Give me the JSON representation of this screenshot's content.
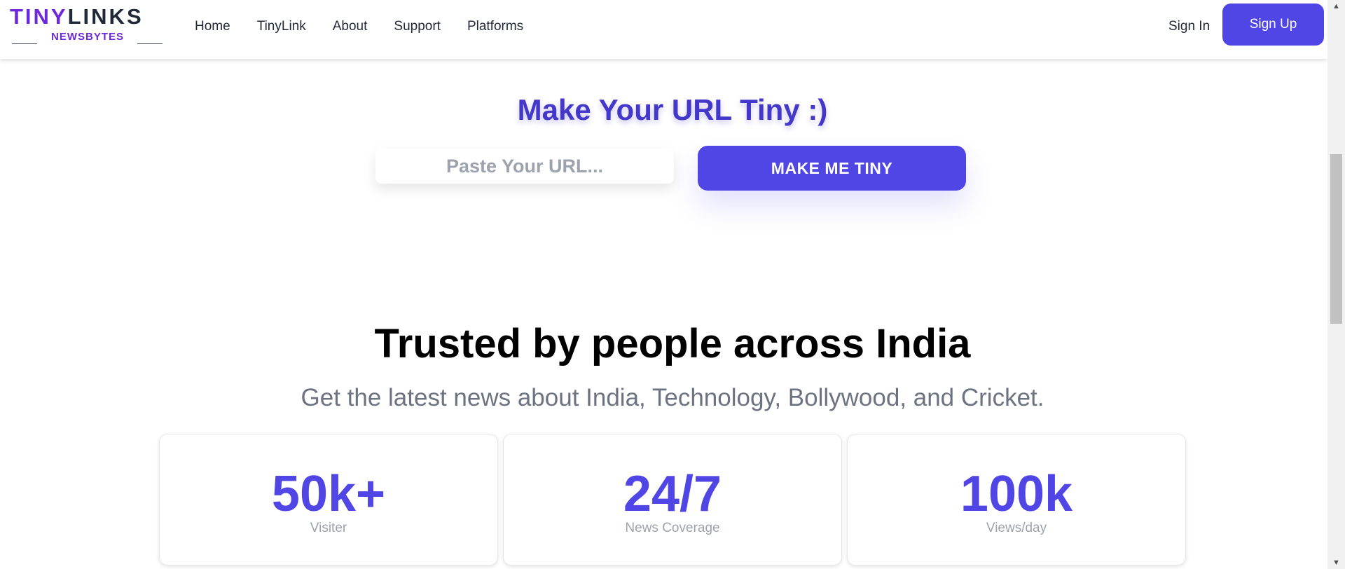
{
  "header": {
    "logo": {
      "main_part1": "TINY",
      "main_part2": "LINKS",
      "sub": "NEWSBYTES"
    },
    "nav": [
      {
        "label": "Home"
      },
      {
        "label": "TinyLink"
      },
      {
        "label": "About"
      },
      {
        "label": "Support"
      },
      {
        "label": "Platforms"
      }
    ],
    "sign_in": "Sign In",
    "sign_up": "Sign Up"
  },
  "hero": {
    "title": "Make Your URL Tiny :)",
    "url_input": {
      "placeholder": "Paste Your URL...",
      "value": ""
    },
    "button": "MAKE ME TINY"
  },
  "trust": {
    "heading": "Trusted by people across India",
    "subheading": "Get the latest news about India, Technology, Bollywood, and Cricket.",
    "stats": [
      {
        "value": "50k+",
        "label": "Visiter"
      },
      {
        "value": "24/7",
        "label": "News Coverage"
      },
      {
        "value": "100k",
        "label": "Views/day"
      }
    ]
  },
  "colors": {
    "accent": "#4f46e5",
    "title": "#4338ca",
    "logo_purple": "#6d28d9",
    "muted": "#6b7280"
  },
  "icons": {
    "scroll_up": "triangle-up",
    "scroll_down": "triangle-down"
  }
}
